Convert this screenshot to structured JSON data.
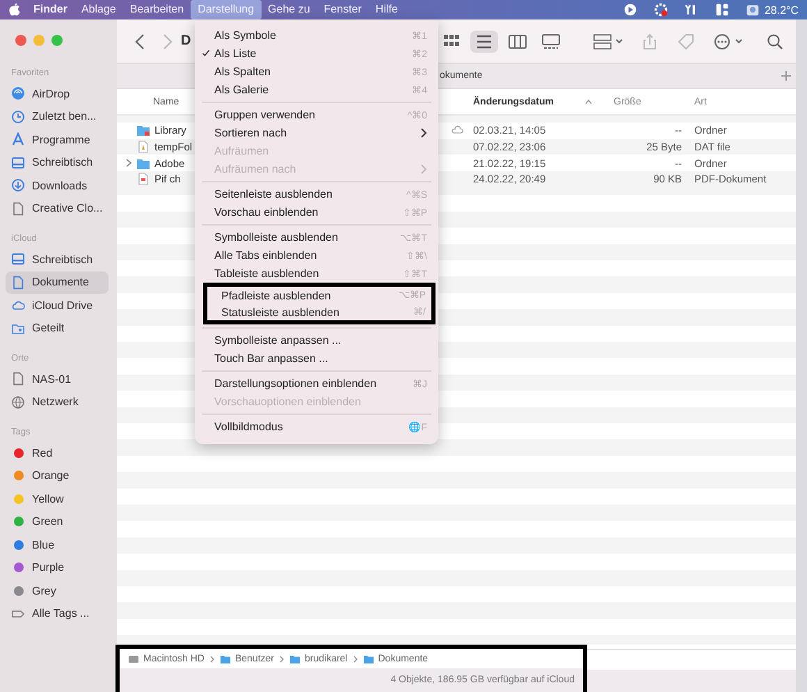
{
  "menubar": {
    "items": [
      {
        "label": "Finder",
        "kind": "app",
        "selected": false
      },
      {
        "label": "Ablage",
        "kind": "menu",
        "selected": false
      },
      {
        "label": "Bearbeiten",
        "kind": "menu",
        "selected": false
      },
      {
        "label": "Darstellung",
        "kind": "menu",
        "selected": true
      },
      {
        "label": "Gehe zu",
        "kind": "menu",
        "selected": false
      },
      {
        "label": "Fenster",
        "kind": "menu",
        "selected": false
      },
      {
        "label": "Hilfe",
        "kind": "menu",
        "selected": false
      }
    ],
    "temperature": "28.2°C"
  },
  "sidebar": {
    "sections": [
      {
        "title": "Favoriten",
        "items": [
          {
            "label": "AirDrop",
            "kind": "place",
            "selected": false
          },
          {
            "label": "Zuletzt ben...",
            "kind": "place",
            "selected": false
          },
          {
            "label": "Programme",
            "kind": "place",
            "selected": false
          },
          {
            "label": "Schreibtisch",
            "kind": "place",
            "selected": false
          },
          {
            "label": "Downloads",
            "kind": "place",
            "selected": false
          },
          {
            "label": "Creative Clo...",
            "kind": "place",
            "selected": false
          }
        ]
      },
      {
        "title": "iCloud",
        "items": [
          {
            "label": "Schreibtisch",
            "kind": "place",
            "selected": false
          },
          {
            "label": "Dokumente",
            "kind": "place",
            "selected": true
          },
          {
            "label": "iCloud Drive",
            "kind": "place",
            "selected": false
          },
          {
            "label": "Geteilt",
            "kind": "place",
            "selected": false
          }
        ]
      },
      {
        "title": "Orte",
        "items": [
          {
            "label": "NAS-01",
            "kind": "place",
            "selected": false
          },
          {
            "label": "Netzwerk",
            "kind": "place",
            "selected": false
          }
        ]
      },
      {
        "title": "Tags",
        "items": [
          {
            "label": "Red",
            "kind": "tag",
            "color": "#e8262a",
            "selected": false
          },
          {
            "label": "Orange",
            "kind": "tag",
            "color": "#f08a24",
            "selected": false
          },
          {
            "label": "Yellow",
            "kind": "tag",
            "color": "#f5c324",
            "selected": false
          },
          {
            "label": "Green",
            "kind": "tag",
            "color": "#2fb344",
            "selected": false
          },
          {
            "label": "Blue",
            "kind": "tag",
            "color": "#2f7de1",
            "selected": false
          },
          {
            "label": "Purple",
            "kind": "tag",
            "color": "#a65ad0",
            "selected": false
          },
          {
            "label": "Grey",
            "kind": "tag",
            "color": "#8a8a8e",
            "selected": false
          },
          {
            "label": "Alle Tags ...",
            "kind": "all-tags",
            "selected": false
          }
        ]
      }
    ]
  },
  "toolbar": {
    "title": "D",
    "view_modes": [
      {
        "selected": false
      },
      {
        "selected": true
      },
      {
        "selected": false
      },
      {
        "selected": false
      }
    ]
  },
  "tab_bar": {
    "tabs": [
      {
        "label": "okumente"
      }
    ]
  },
  "table": {
    "columns": [
      {
        "label": "Name",
        "sorted": false
      },
      {
        "label": "Änderungsdatum",
        "sorted": true
      },
      {
        "label": "Größe",
        "sorted": false
      },
      {
        "label": "Art",
        "sorted": false
      }
    ],
    "rows": [
      {
        "name": "Library",
        "date": "02.03.21, 14:05",
        "size": "--",
        "type": "Ordner",
        "in_cloud": true,
        "expandable": false
      },
      {
        "name": "tempFol",
        "date": "07.02.22, 23:06",
        "size": "25 Byte",
        "type": "DAT file",
        "in_cloud": false,
        "expandable": false
      },
      {
        "name": "Adobe",
        "date": "21.02.22, 19:15",
        "size": "--",
        "type": "Ordner",
        "in_cloud": false,
        "expandable": true
      },
      {
        "name": "Pif ch",
        "date": "24.02.22, 20:49",
        "size": "90 KB",
        "type": "PDF-Dokument",
        "in_cloud": false,
        "expandable": false
      }
    ]
  },
  "path_bar": {
    "crumbs": [
      "Macintosh HD",
      "Benutzer",
      "brudikarel",
      "Dokumente"
    ],
    "highlighted": true
  },
  "status_bar": {
    "text": "4 Objekte, 186.95 GB verfügbar auf iCloud"
  },
  "menu": {
    "sections": [
      [
        {
          "label": "Als Symbole",
          "shortcut": "⌘1",
          "checked": false,
          "disabled": false,
          "submenu": false,
          "highlighted": false
        },
        {
          "label": "Als Liste",
          "shortcut": "⌘2",
          "checked": true,
          "disabled": false,
          "submenu": false,
          "highlighted": false
        },
        {
          "label": "Als Spalten",
          "shortcut": "⌘3",
          "checked": false,
          "disabled": false,
          "submenu": false,
          "highlighted": false
        },
        {
          "label": "Als Galerie",
          "shortcut": "⌘4",
          "checked": false,
          "disabled": false,
          "submenu": false,
          "highlighted": false
        }
      ],
      [
        {
          "label": "Gruppen verwenden",
          "shortcut": "^⌘0",
          "checked": false,
          "disabled": false,
          "submenu": false,
          "highlighted": false
        },
        {
          "label": "Sortieren nach",
          "checked": false,
          "disabled": false,
          "submenu": true,
          "highlighted": false
        },
        {
          "label": "Aufräumen",
          "checked": false,
          "disabled": true,
          "submenu": false,
          "highlighted": false
        },
        {
          "label": "Aufräumen nach",
          "checked": false,
          "disabled": true,
          "submenu": true,
          "highlighted": false
        }
      ],
      [
        {
          "label": "Seitenleiste ausblenden",
          "shortcut": "^⌘S",
          "checked": false,
          "disabled": false,
          "submenu": false,
          "highlighted": false
        },
        {
          "label": "Vorschau einblenden",
          "shortcut": "⇧⌘P",
          "checked": false,
          "disabled": false,
          "submenu": false,
          "highlighted": false
        }
      ],
      [
        {
          "label": "Symbolleiste ausblenden",
          "shortcut": "⌥⌘T",
          "checked": false,
          "disabled": false,
          "submenu": false,
          "highlighted": false
        },
        {
          "label": "Alle Tabs einblenden",
          "shortcut": "⇧⌘\\",
          "checked": false,
          "disabled": false,
          "submenu": false,
          "highlighted": false
        },
        {
          "label": "Tableiste ausblenden",
          "shortcut": "⇧⌘T",
          "checked": false,
          "disabled": false,
          "submenu": false,
          "highlighted": false
        },
        {
          "label": "Pfadleiste ausblenden",
          "shortcut": "⌥⌘P",
          "checked": false,
          "disabled": false,
          "submenu": false,
          "highlighted": true
        },
        {
          "label": "Statusleiste ausblenden",
          "shortcut": "⌘/",
          "checked": false,
          "disabled": false,
          "submenu": false,
          "highlighted": true
        }
      ],
      [
        {
          "label": "Symbolleiste anpassen ...",
          "checked": false,
          "disabled": false,
          "submenu": false,
          "highlighted": false
        },
        {
          "label": "Touch Bar anpassen ...",
          "checked": false,
          "disabled": false,
          "submenu": false,
          "highlighted": false
        }
      ],
      [
        {
          "label": "Darstellungsoptionen einblenden",
          "shortcut": "⌘J",
          "checked": false,
          "disabled": false,
          "submenu": false,
          "highlighted": false
        },
        {
          "label": "Vorschauoptionen einblenden",
          "checked": false,
          "disabled": true,
          "submenu": false,
          "highlighted": false
        }
      ],
      [
        {
          "label": "Vollbildmodus",
          "shortcut": "🌐F",
          "checked": false,
          "disabled": false,
          "submenu": false,
          "highlighted": false
        }
      ]
    ]
  }
}
